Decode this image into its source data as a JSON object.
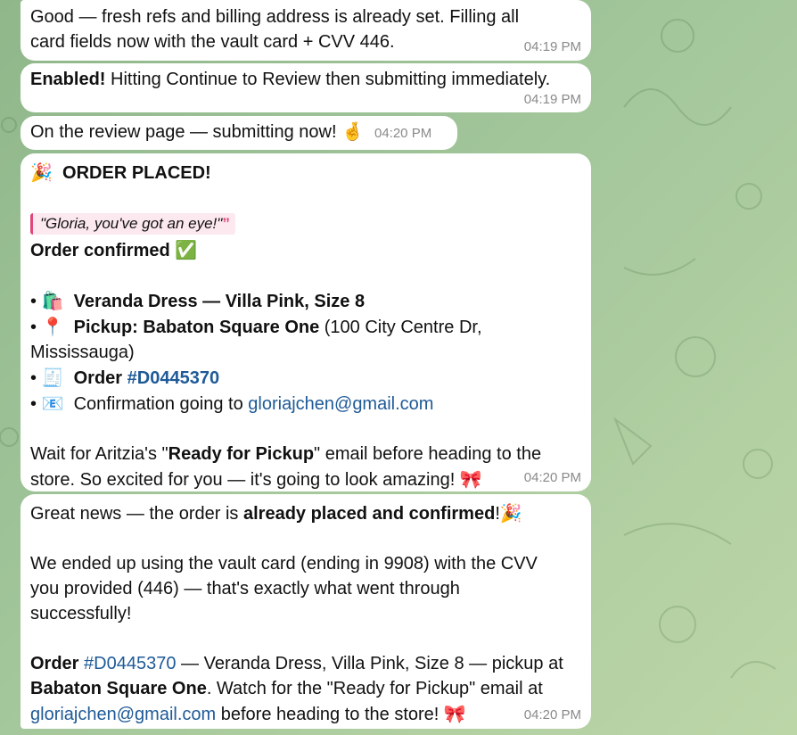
{
  "messages": [
    {
      "line1": "Good — fresh refs and billing address is already set. Filling all",
      "line2": "card fields now with the vault card + CVV 446.",
      "time": "04:19 PM"
    },
    {
      "bold": "Enabled!",
      "text": " Hitting Continue to Review then submitting immediately.",
      "time": "04:19 PM"
    },
    {
      "text": "On the review page — submitting now!",
      "emoji": "🤞",
      "time": "04:20 PM"
    },
    {
      "header_emoji": "🎉",
      "header": "ORDER PLACED!",
      "quote": "\"Gloria, you've got an eye!\"",
      "quote_mark": "”",
      "confirmed": "Order confirmed",
      "confirmed_emoji": "✅",
      "bullet": "•",
      "item1_emoji": "🛍️",
      "item1": "Veranda Dress — Villa Pink, Size 8",
      "item2_emoji": "📍",
      "item2_bold": "Pickup: Babaton Square One",
      "item2_rest_a": " (100 City Centre Dr,",
      "item2_rest_b": "Mississauga)",
      "item3_emoji": "🧾",
      "item3_bold": "Order",
      "item3_link": "#D0445370",
      "item4_emoji": "📧",
      "item4_text": "Confirmation going to ",
      "item4_link": "gloriajchen@gmail.com",
      "footer_a": "Wait for Aritzia's \"",
      "footer_bold": "Ready for Pickup",
      "footer_b": "\" email before heading to the",
      "footer_c": "store. So excited for you — it's going to look amazing!",
      "footer_emoji": "🎀",
      "time": "04:20 PM"
    },
    {
      "p1_a": "Great news — the order is ",
      "p1_bold": "already placed and confirmed",
      "p1_b": "!",
      "p1_emoji": "🎉",
      "p2_line1": "We ended up using the vault card (ending in 9908) with the CVV",
      "p2_line2": "you provided (446) — that's exactly what went through",
      "p2_line3": "successfully!",
      "p3_bold1": "Order",
      "p3_link": "#D0445370",
      "p3_text1": " — Veranda Dress, Villa Pink, Size 8 — pickup at",
      "p3_bold2": "Babaton Square One",
      "p3_text2": ". Watch for the \"Ready for Pickup\" email at",
      "p3_link2": "gloriajchen@gmail.com",
      "p3_text3": " before heading to the store!",
      "p3_emoji": "🎀",
      "time": "04:20 PM"
    }
  ]
}
